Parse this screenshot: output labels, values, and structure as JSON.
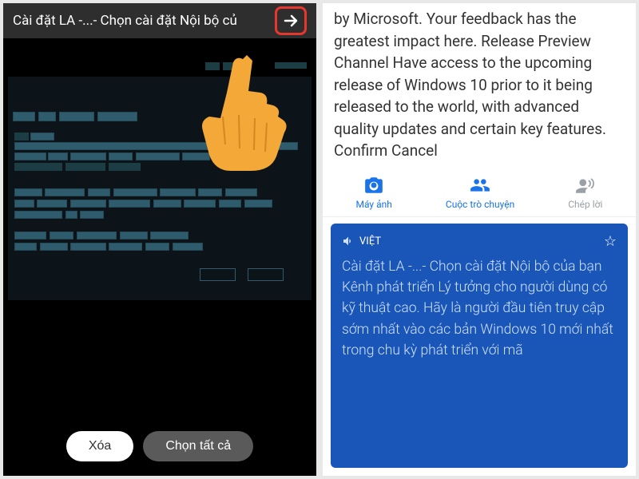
{
  "left": {
    "title": "Cài đặt LA -...- Chọn cài đặt Nội bộ củ",
    "buttons": {
      "clear": "Xóa",
      "selectAll": "Chọn tất cả"
    }
  },
  "right": {
    "sourceText": "by Microsoft. Your feedback has the greatest impact here. Release Preview Channel Have access to the upcoming release of Windows 10 prior to it being released to the world, with advanced quality updates and certain key features. Confirm Cancel",
    "tabs": {
      "camera": "Máy ảnh",
      "chat": "Cuộc trò chuyện",
      "transcribe": "Chép lời"
    },
    "translation": {
      "langLabel": "VIỆT",
      "body": "Cài đặt LA -...- Chọn cài đặt Nội bộ của bạn Kênh phát triển Lý tưởng cho người dùng có kỹ thuật cao.  Hãy là người đầu tiên truy cập sớm nhất vào các bản Windows 10 mới nhất trong chu kỳ phát triển với mã"
    }
  }
}
